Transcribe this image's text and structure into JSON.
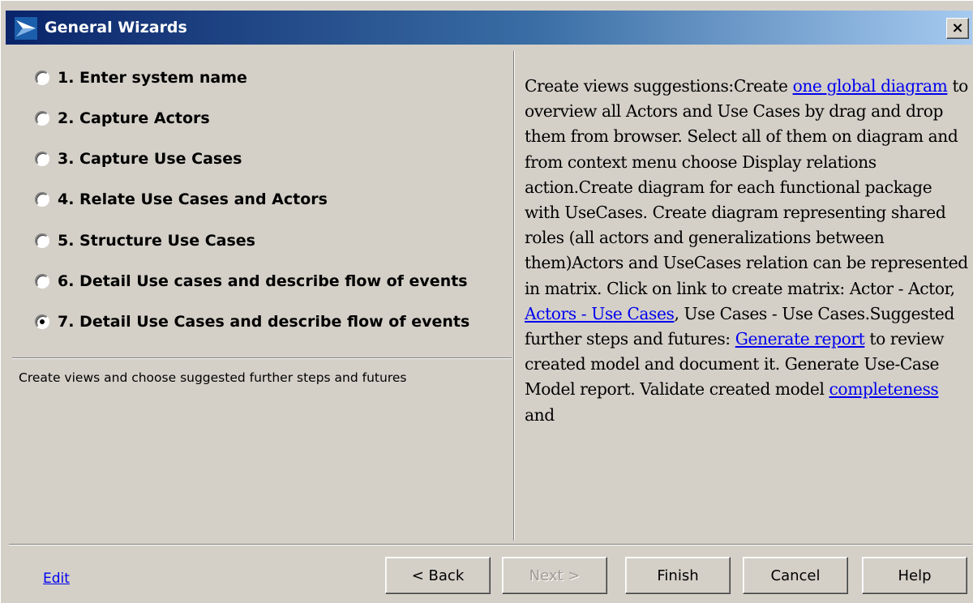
{
  "window": {
    "title": "General Wizards",
    "close_label": "×"
  },
  "steps": [
    {
      "label": "1. Enter system name",
      "selected": false
    },
    {
      "label": "2. Capture Actors",
      "selected": false
    },
    {
      "label": "3. Capture Use Cases",
      "selected": false
    },
    {
      "label": "4. Relate Use Cases and Actors",
      "selected": false
    },
    {
      "label": "5. Structure Use Cases",
      "selected": false
    },
    {
      "label": "6. Detail Use cases and describe flow of events",
      "selected": false
    },
    {
      "label": "7. Detail Use Cases and describe flow of events",
      "selected": true
    }
  ],
  "step_description": "Create views and choose suggested further steps and futures",
  "info": {
    "t1": "Create views suggestions:Create ",
    "link_global_diagram": "one global diagram",
    "t2": " to overview all Actors and Use Cases by drag and drop them from browser. Select all of them on diagram and from context menu choose Display relations action.Create diagram for each functional package with UseCases. Create diagram representing shared roles (all actors and generalizations between them)Actors and UseCases relation can be represented in matrix. Click on link to create matrix: Actor - Actor, ",
    "link_actors_use_cases": "Actors - Use Cases",
    "t3": ", Use Cases - Use Cases.Suggested further steps and futures: ",
    "link_generate_report": "Generate report",
    "t4": " to review created model and document it. Generate Use-Case Model report. Validate created model ",
    "link_completeness": "completeness",
    "t5": " and"
  },
  "footer": {
    "edit_label": "Edit",
    "back_label": "< Back",
    "next_label": "Next >",
    "finish_label": "Finish",
    "cancel_label": "Cancel",
    "help_label": "Help"
  }
}
